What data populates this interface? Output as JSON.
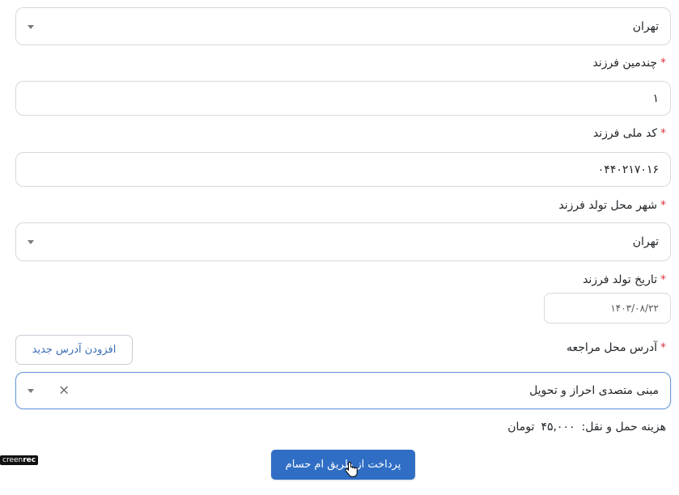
{
  "province_select": {
    "value": "تهران"
  },
  "child_order": {
    "label": "چندمین فرزند",
    "required_mark": "*",
    "value": "۱"
  },
  "child_national_code": {
    "label": "کد ملی فرزند",
    "required_mark": "*",
    "value": "۰۴۴۰۲۱۷۰۱۶"
  },
  "child_birth_city": {
    "label": "شهر محل تولد فرزند",
    "required_mark": "*",
    "value": "تهران"
  },
  "child_birth_date": {
    "label": "تاریخ تولد فرزند",
    "required_mark": "*",
    "value": "۱۴۰۳/۰۸/۲۲"
  },
  "applicant_address": {
    "label": "آدرس محل مراجعه",
    "required_mark": "*",
    "add_button_label": "افزودن آدرس جدید",
    "selected_value": "مبنی متصدی احراز و تحویل",
    "clear_symbol": "×"
  },
  "shipping": {
    "label": "هزینه حمل و نقل:",
    "amount": "۴۵,۰۰۰",
    "currency": "تومان"
  },
  "pay_button": {
    "label": "پرداخت از طریق ام حسام"
  },
  "watermark": {
    "prefix": "creen",
    "suffix": "rec"
  },
  "colors": {
    "primary": "#2f6ec4",
    "required": "#dc3545",
    "focus_border": "#6b9ad6"
  }
}
